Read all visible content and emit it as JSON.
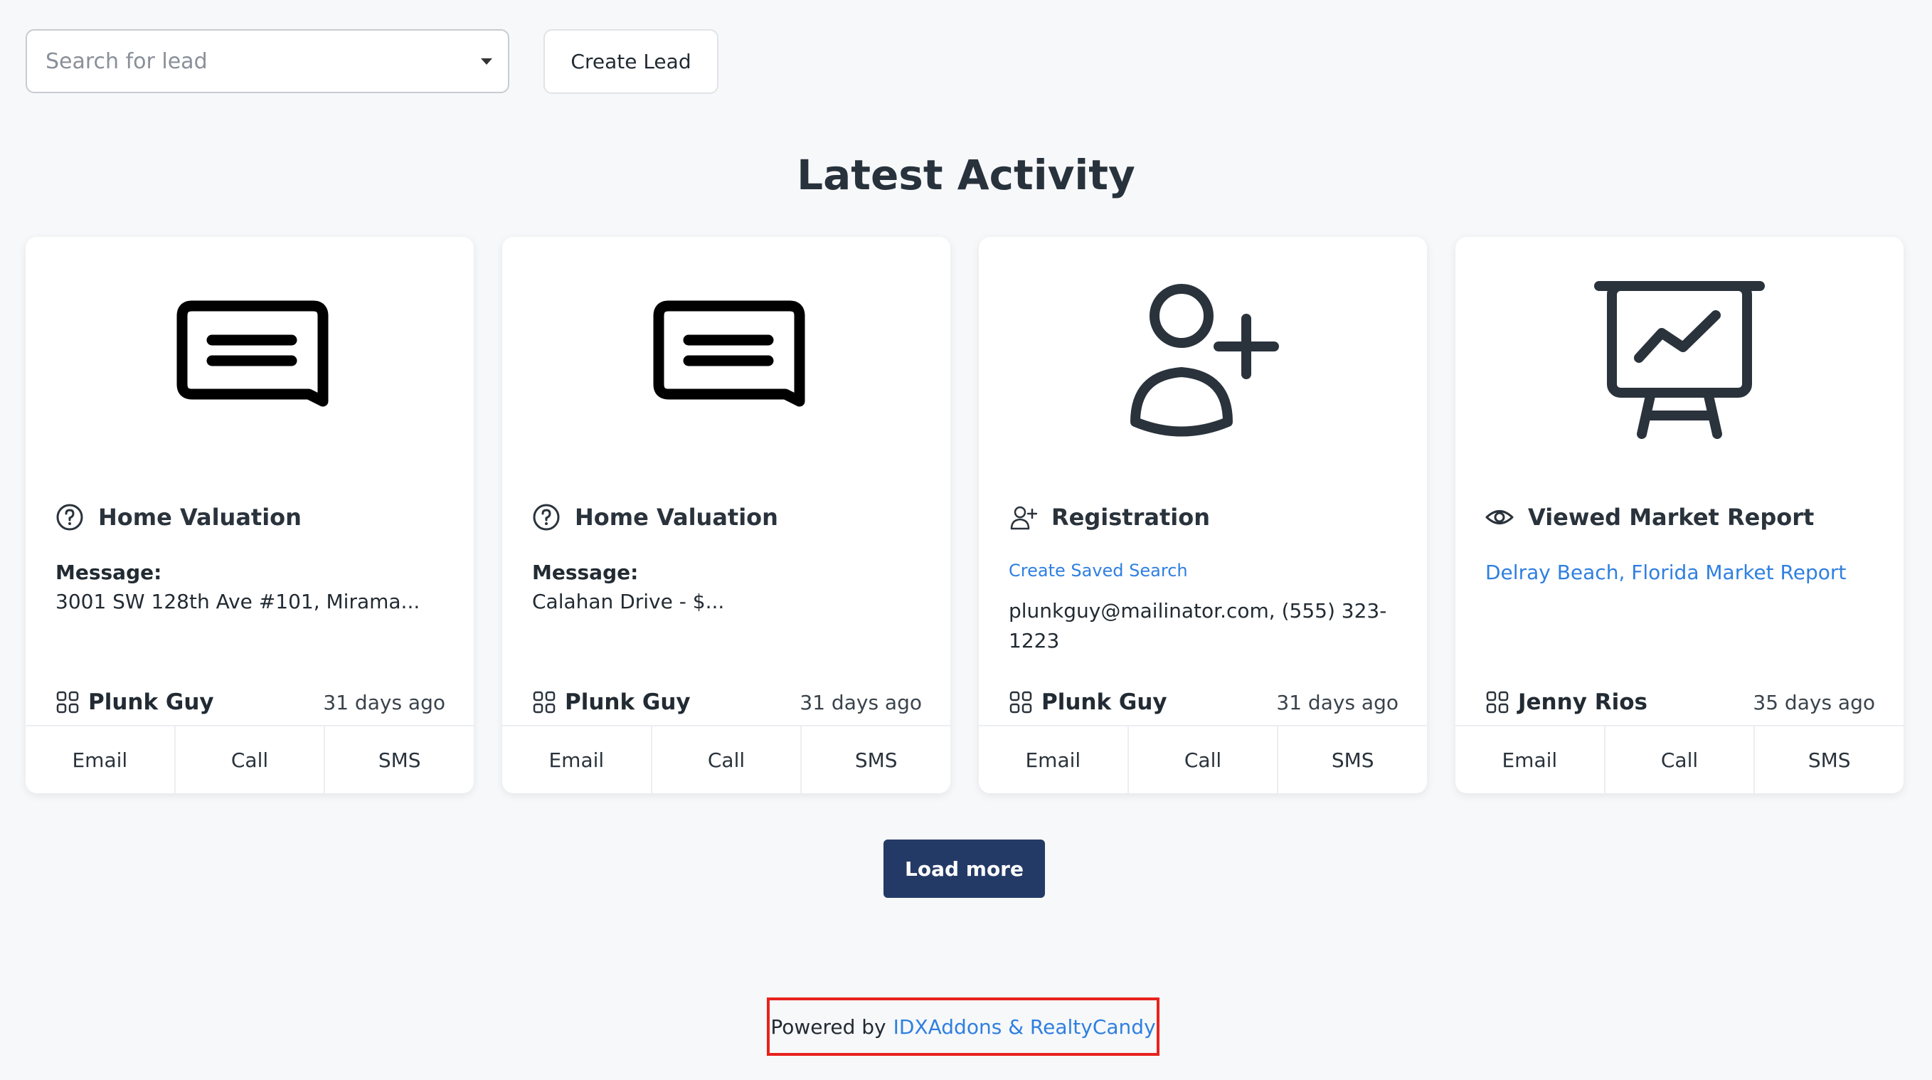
{
  "search": {
    "placeholder": "Search for lead"
  },
  "toolbar": {
    "create_label": "Create Lead"
  },
  "page": {
    "title": "Latest Activity"
  },
  "cards": [
    {
      "type": "Home Valuation",
      "message_label": "Message:",
      "message": "3001 SW 128th Ave #101, Mirama...",
      "lead": "Plunk Guy",
      "time": "31 days ago",
      "actions": [
        "Email",
        "Call",
        "SMS"
      ]
    },
    {
      "type": "Home Valuation",
      "message_label": "Message:",
      "message": "Calahan Drive - $...",
      "lead": "Plunk Guy",
      "time": "31 days ago",
      "actions": [
        "Email",
        "Call",
        "SMS"
      ]
    },
    {
      "type": "Registration",
      "link": "Create Saved Search",
      "contact": "plunkguy@mailinator.com, (555) 323-1223",
      "lead": "Plunk Guy",
      "time": "31 days ago",
      "actions": [
        "Email",
        "Call",
        "SMS"
      ]
    },
    {
      "type": "Viewed Market Report",
      "link": "Delray Beach, Florida Market Report",
      "lead": "Jenny Rios",
      "time": "35 days ago",
      "actions": [
        "Email",
        "Call",
        "SMS"
      ]
    }
  ],
  "load_more": "Load more",
  "footer": {
    "prefix": "Powered by",
    "link": "IDXAddons & RealtyCandy"
  },
  "colors": {
    "accent": "#2f7fe0",
    "primary_button": "#243a66",
    "footer_border": "#e8221d"
  }
}
